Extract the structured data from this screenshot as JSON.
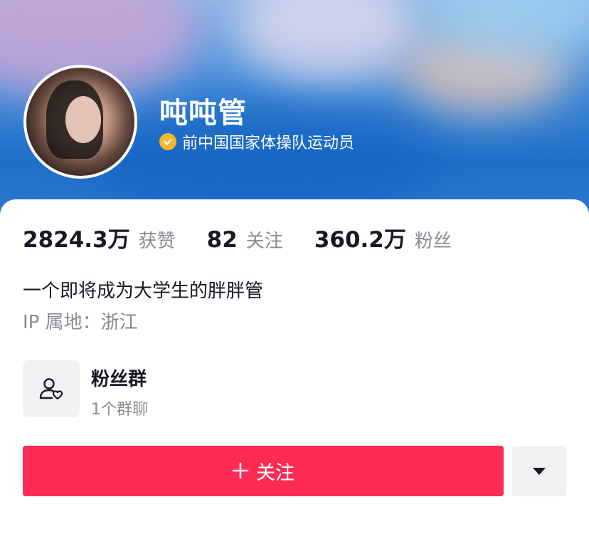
{
  "profile": {
    "name": "吨吨管",
    "verification": "前中国国家体操队运动员",
    "bio": "一个即将成为大学生的胖胖管",
    "ip_location": "IP 属地：浙江"
  },
  "stats": {
    "likes": {
      "value": "2824.3万",
      "label": "获赞"
    },
    "following": {
      "value": "82",
      "label": "关注"
    },
    "followers": {
      "value": "360.2万",
      "label": "粉丝"
    }
  },
  "fan_group": {
    "title": "粉丝群",
    "subtitle": "1个群聊",
    "icon": "user-heart-icon"
  },
  "actions": {
    "follow_label": "关注",
    "follow_icon": "plus-icon",
    "more_icon": "triangle-down-icon"
  },
  "colors": {
    "accent": "#fe2c55",
    "verify_badge": "#f5b72f",
    "text_primary": "#161823",
    "text_secondary": "#8a8b91"
  }
}
